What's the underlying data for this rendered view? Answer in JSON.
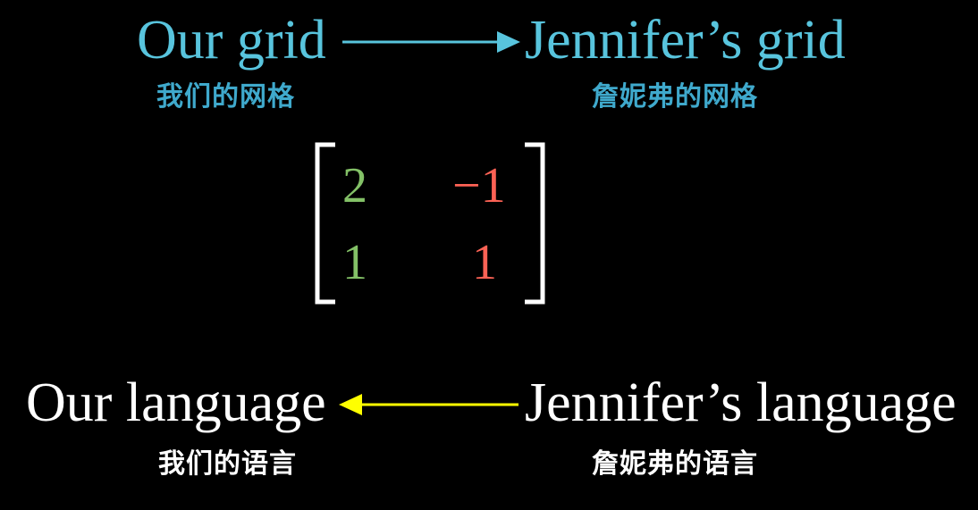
{
  "colors": {
    "blue": "#58c4dd",
    "green": "#83c167",
    "red": "#fc6255",
    "yellow": "#ffff00",
    "white": "#ffffff"
  },
  "top": {
    "left_label": "Our grid",
    "left_label_zh": "我们的网格",
    "right_label": "Jennifer’s grid",
    "right_label_zh": "詹妮弗的网格",
    "arrow_direction": "right"
  },
  "matrix": {
    "rows": [
      [
        "2",
        "−1"
      ],
      [
        "1",
        "1"
      ]
    ],
    "column_colors": [
      "green",
      "red"
    ]
  },
  "bottom": {
    "left_label": "Our language",
    "left_label_zh": "我们的语言",
    "right_label": "Jennifer’s language",
    "right_label_zh": "詹妮弗的语言",
    "arrow_direction": "left"
  }
}
